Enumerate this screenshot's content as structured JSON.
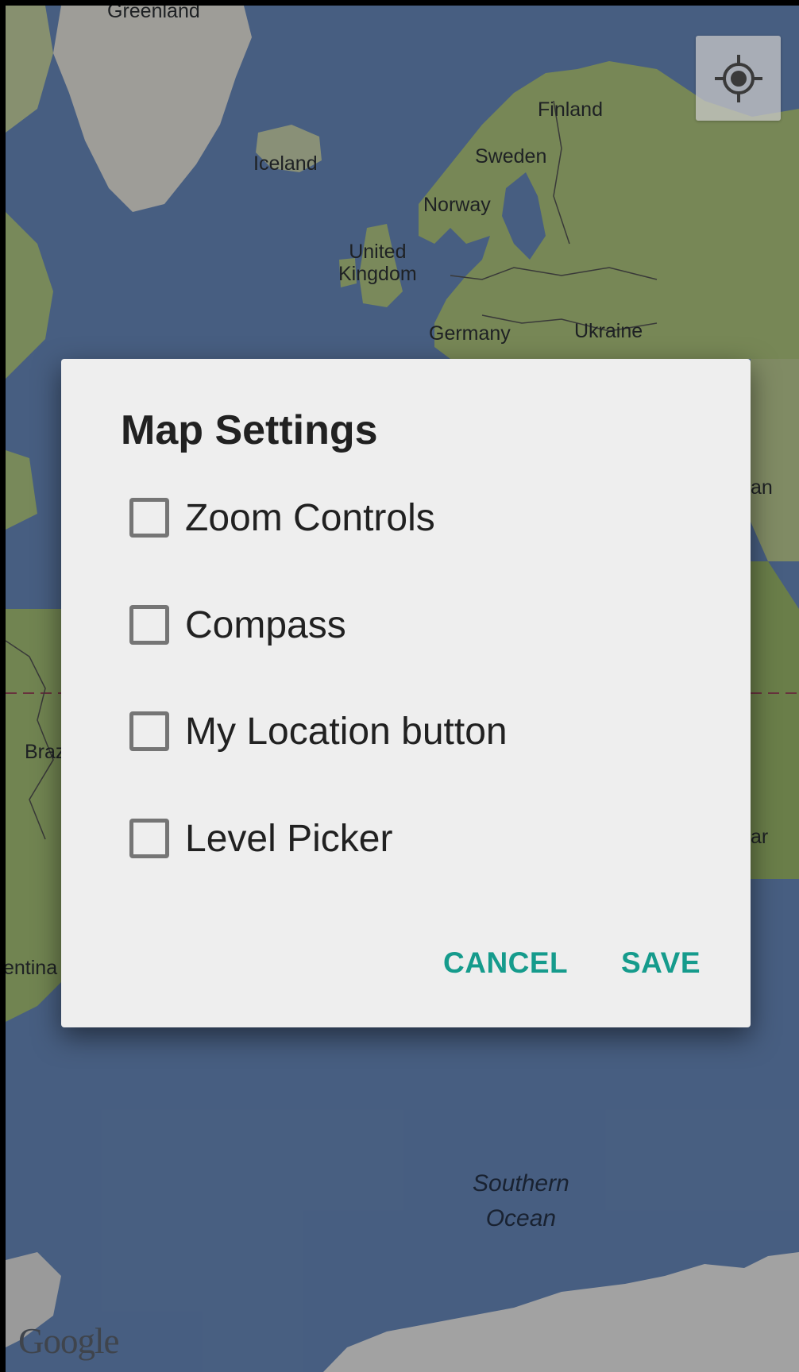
{
  "map": {
    "labels": {
      "greenland": "Greenland",
      "iceland": "Iceland",
      "finland": "Finland",
      "sweden": "Sweden",
      "norway": "Norway",
      "united_kingdom_line1": "United",
      "united_kingdom_line2": "Kingdom",
      "germany": "Germany",
      "ukraine": "Ukraine",
      "partial_right_an": "an",
      "partial_left_brazil": "Braz",
      "partial_right_ar": "ar",
      "partial_left_argentina": "entina",
      "southern_ocean_line1": "Southern",
      "southern_ocean_line2": "Ocean"
    },
    "attribution": "Google",
    "colors": {
      "water": "#6b8dc0",
      "land": "#b9d38c",
      "ice": "#f2f2f2"
    }
  },
  "my_location_button": {
    "icon": "my-location-icon"
  },
  "dialog": {
    "title": "Map Settings",
    "options": [
      {
        "label": "Zoom Controls",
        "checked": false
      },
      {
        "label": "Compass",
        "checked": false
      },
      {
        "label": "My Location button",
        "checked": false
      },
      {
        "label": "Level Picker",
        "checked": false
      }
    ],
    "cancel_label": "CANCEL",
    "save_label": "SAVE",
    "accent_color": "#159b8c"
  }
}
